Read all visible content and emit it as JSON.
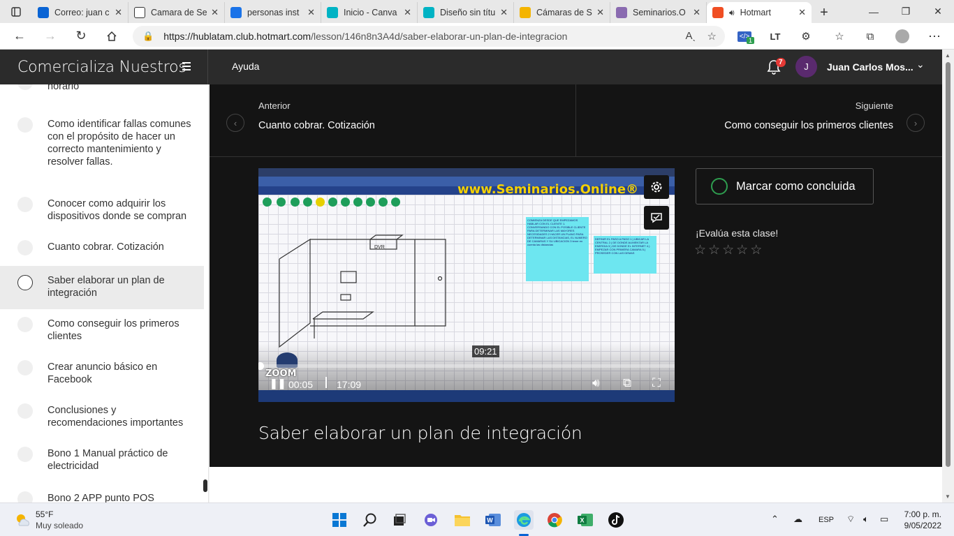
{
  "browser": {
    "tabs": [
      {
        "label": "Correo: juan c",
        "favicon_color": "#0a64d4"
      },
      {
        "label": "Camara de Se",
        "favicon_color": "#ffffff"
      },
      {
        "label": "personas inst",
        "favicon_color": "#1a73e8"
      },
      {
        "label": "Inicio - Canva",
        "favicon_color": "#00b3c4"
      },
      {
        "label": "Diseño sin títu",
        "favicon_color": "#00b3c4"
      },
      {
        "label": "Cámaras de S",
        "favicon_color": "#f4b400"
      },
      {
        "label": "Seminarios.O",
        "favicon_color": "#8a6bb0"
      },
      {
        "label": "Hotmart",
        "favicon_color": "#f04e23",
        "active": true
      }
    ],
    "url_host": "https://hublatam.club.hotmart.com",
    "url_path": "/lesson/146n8n3A4d/saber-elaborar-un-plan-de-integracion",
    "extension_badge": "1"
  },
  "header": {
    "brand": "Comercializa Nuestros",
    "help_link": "Ayuda",
    "notification_count": "7",
    "avatar_initial": "J",
    "user_name": "Juan Carlos Mos..."
  },
  "sidebar": {
    "lessons": [
      {
        "label": "horario"
      },
      {
        "label": "Como identificar fallas comunes con el propósito de hacer un correcto mantenimiento y resolver fallas."
      },
      {
        "label": "Conocer como adquirir los dispositivos donde se compran"
      },
      {
        "label": "Cuanto cobrar. Cotización"
      },
      {
        "label": "Saber elaborar un plan de integración",
        "current": true
      },
      {
        "label": "Como conseguir los primeros clientes"
      },
      {
        "label": "Crear anuncio básico en Facebook"
      },
      {
        "label": "Conclusiones y recomendaciones importantes"
      },
      {
        "label": "Bono 1 Manual práctico de electricidad"
      },
      {
        "label": "Bono 2 APP punto POS"
      }
    ]
  },
  "lesson_nav": {
    "prev_small": "Anterior",
    "prev_title": "Cuanto cobrar. Cotización",
    "next_small": "Siguiente",
    "next_title": "Como conseguir los primeros clientes"
  },
  "video": {
    "watermark_title": "www.Seminarios.Online®",
    "hover_time": "09:21",
    "current_time": "00:05",
    "duration": "17:09",
    "progress": 0.005,
    "zoom_label": "ZOOM",
    "note1": "COMIENZA DESDE QUE EMPEZAMOS HABLAR CON EL CLIENTE 1. CONVERSANDO CON EL POSIBLE CLIENTE PARA DETERMINAR LAS MAYORES NECESIDADES 2 HACER UN PLANO PARA DETERMINAR LAS DISTANCIAS, EL NUMERO DE CAMARAS Y SU UBICACION 3 tener en cuenta las distancias",
    "note2": "DEFINIR EL PASO A PASO 1.) UBICAR LA CENTRAL 2.) DE DONDE ALIMENTAR LA ENERGIA 3.) DE DONDE EL INTERNET 4.) EMPEZAR CON PRIMERA CAMARA 5.) PROSEDER CON LAS DEMAS",
    "dvr_label": "DVR"
  },
  "actions": {
    "complete_label": "Marcar como concluida",
    "rate_label": "¡Evalúa esta clase!",
    "stars": 5,
    "rating": 0
  },
  "lesson_title": "Saber elaborar un plan de integración",
  "taskbar": {
    "weather_temp": "55°F",
    "weather_desc": "Muy soleado",
    "language": "ESP",
    "time": "7:00 p. m.",
    "date": "9/05/2022"
  },
  "colors": {
    "header_bg": "#2b2b2b",
    "main_bg": "#141414",
    "complete_ring": "#2e9e4f",
    "badge": "#e53935"
  }
}
